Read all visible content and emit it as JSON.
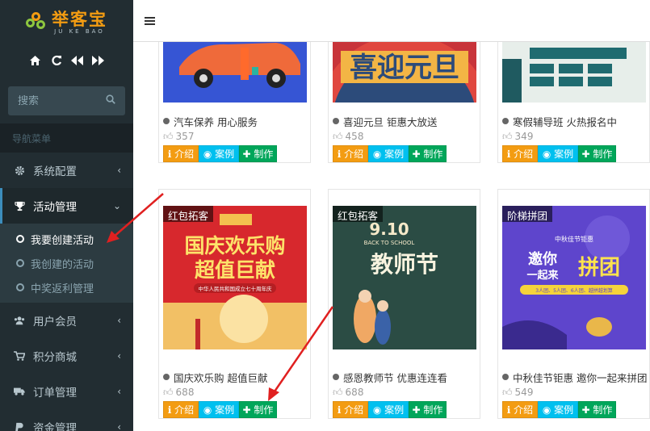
{
  "app": {
    "logo_text": "举客宝",
    "logo_sub": "JU KE BAO"
  },
  "sidebar": {
    "search_placeholder": "搜索",
    "nav_header": "导航菜单",
    "items": [
      {
        "label": "系统配置",
        "icon": "gear-icon"
      },
      {
        "label": "活动管理",
        "icon": "trophy-icon"
      },
      {
        "label": "用户会员",
        "icon": "users-icon"
      },
      {
        "label": "积分商城",
        "icon": "cart-icon"
      },
      {
        "label": "订单管理",
        "icon": "truck-icon"
      },
      {
        "label": "资金管理",
        "icon": "paypal-icon"
      }
    ],
    "submenu": [
      {
        "label": "我要创建活动"
      },
      {
        "label": "我创建的活动"
      },
      {
        "label": "中奖返利管理"
      }
    ]
  },
  "cards": [
    {
      "title": "汽车保养 用心服务",
      "likes": "357",
      "badge": ""
    },
    {
      "title": "喜迎元旦 钜惠大放送",
      "likes": "458",
      "badge": ""
    },
    {
      "title": "寒假辅导班 火热报名中",
      "likes": "349",
      "badge": ""
    },
    {
      "title": "国庆欢乐购 超值巨献",
      "likes": "688",
      "badge": "红包拓客"
    },
    {
      "title": "感恩教师节 优惠连连看",
      "likes": "688",
      "badge": "红包拓客"
    },
    {
      "title": "中秋佳节钜惠 邀你一起来拼团",
      "likes": "549",
      "badge": "阶梯拼团"
    }
  ],
  "buttons": {
    "intro": "介绍",
    "case": "案例",
    "make": "制作"
  },
  "posters": {
    "guoqing_line1": "国庆欢乐购",
    "guoqing_line2": "超值巨献",
    "guoqing_small": "中华人民共和国成立七十周年庆",
    "teacher_date": "9.10",
    "teacher_sub": "BACK TO SCHOOL",
    "teacher_title": "教师节",
    "pt_top": "中秋佳节钜惠",
    "pt_main1": "邀你",
    "pt_main2": "一起来",
    "pt_main3": "拼团",
    "pt_bottom": "3人团、5人团、6人团、越拼越划算"
  }
}
